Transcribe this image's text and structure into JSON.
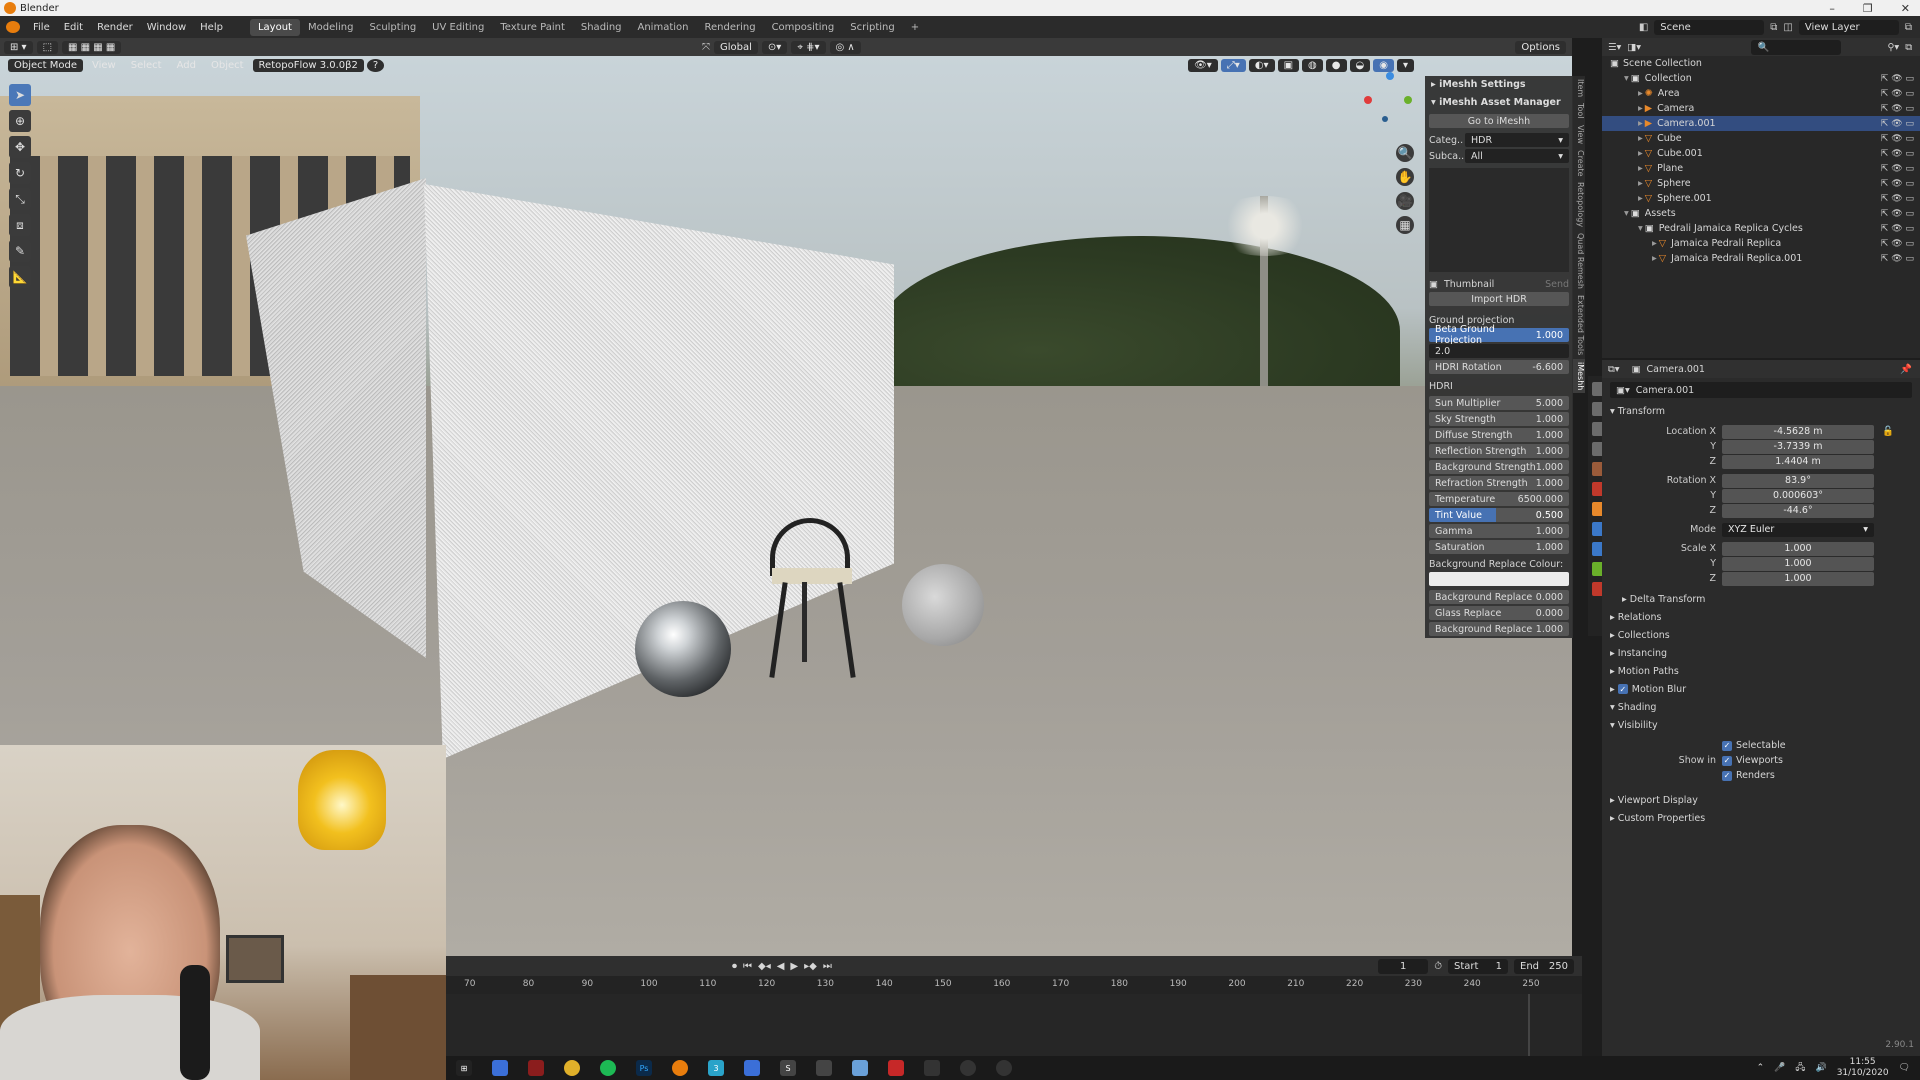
{
  "window": {
    "title": "Blender",
    "minimize": "–",
    "restore": "❐",
    "close": "✕"
  },
  "menu": {
    "items": [
      "File",
      "Edit",
      "Render",
      "Window",
      "Help"
    ],
    "workspaces": [
      "Layout",
      "Modeling",
      "Sculpting",
      "UV Editing",
      "Texture Paint",
      "Shading",
      "Animation",
      "Rendering",
      "Compositing",
      "Scripting",
      "+"
    ],
    "active_workspace": "Layout",
    "scene": "Scene",
    "view_layer": "View Layer"
  },
  "viewport_header": {
    "mode": "Object Mode",
    "view": "View",
    "select": "Select",
    "add": "Add",
    "object": "Object",
    "addon": "RetopoFlow 3.0.0β2",
    "help": "?",
    "orientation": "Global",
    "options": "Options"
  },
  "npanel": {
    "imeshh_settings": "iMeshh Settings",
    "asset_manager": "iMeshh Asset Manager",
    "go_to": "Go to iMeshh",
    "category_label": "Categ..",
    "category_value": "HDR",
    "subcategory_label": "Subca..",
    "subcategory_value": "All",
    "thumbnail": "Thumbnail",
    "send": "Send",
    "import": "Import HDR",
    "ground_projection": "Ground projection",
    "beta_ground": {
      "label": "Beta Ground Projection",
      "value": "1.000"
    },
    "ground_input": "2.0",
    "hdri_rotation": {
      "label": "HDRI Rotation",
      "value": "-6.600"
    },
    "hdri_section": "HDRI",
    "hdri_rows": [
      {
        "label": "Sun Multiplier",
        "value": "5.000"
      },
      {
        "label": "Sky Strength",
        "value": "1.000"
      },
      {
        "label": "Diffuse Strength",
        "value": "1.000"
      },
      {
        "label": "Reflection Strength",
        "value": "1.000"
      },
      {
        "label": "Background Strength",
        "value": "1.000"
      },
      {
        "label": "Refraction Strength",
        "value": "1.000"
      },
      {
        "label": "Temperature",
        "value": "6500.000"
      },
      {
        "label": "Tint Value",
        "value": "0.500"
      },
      {
        "label": "Gamma",
        "value": "1.000"
      },
      {
        "label": "Saturation",
        "value": "1.000"
      }
    ],
    "bg_replace_colour": "Background Replace Colour:",
    "bottom_rows": [
      {
        "label": "Background Replace",
        "value": "0.000"
      },
      {
        "label": "Glass Replace",
        "value": "0.000"
      },
      {
        "label": "Background Replace",
        "value": "1.000"
      }
    ]
  },
  "vtabs": [
    "Item",
    "Tool",
    "View",
    "Create",
    "Retopology",
    "Quad Remesh",
    "Extended Tools",
    "iMeshh"
  ],
  "outliner": {
    "root": "Scene Collection",
    "rows": [
      {
        "name": "Collection",
        "indent": 1,
        "kind": "collection"
      },
      {
        "name": "Area",
        "indent": 2,
        "kind": "light"
      },
      {
        "name": "Camera",
        "indent": 2,
        "kind": "camera"
      },
      {
        "name": "Camera.001",
        "indent": 2,
        "kind": "camera",
        "selected": true
      },
      {
        "name": "Cube",
        "indent": 2,
        "kind": "mesh"
      },
      {
        "name": "Cube.001",
        "indent": 2,
        "kind": "mesh"
      },
      {
        "name": "Plane",
        "indent": 2,
        "kind": "mesh"
      },
      {
        "name": "Sphere",
        "indent": 2,
        "kind": "mesh"
      },
      {
        "name": "Sphere.001",
        "indent": 2,
        "kind": "mesh"
      },
      {
        "name": "Assets",
        "indent": 1,
        "kind": "collection"
      },
      {
        "name": "Pedrali Jamaica Replica Cycles",
        "indent": 2,
        "kind": "collection"
      },
      {
        "name": "Jamaica Pedrali Replica",
        "indent": 3,
        "kind": "mesh"
      },
      {
        "name": "Jamaica Pedrali Replica.001",
        "indent": 3,
        "kind": "mesh"
      }
    ]
  },
  "properties": {
    "object_name": "Camera.001",
    "object_field": "Camera.001",
    "transform": "Transform",
    "location": {
      "label": "Location X",
      "x": "-4.5628 m",
      "y": "-3.7339 m",
      "z": "1.4404 m"
    },
    "rotation": {
      "label": "Rotation X",
      "x": "83.9°",
      "y": "0.000603°",
      "z": "-44.6°"
    },
    "mode": {
      "label": "Mode",
      "value": "XYZ Euler"
    },
    "scale": {
      "label": "Scale X",
      "x": "1.000",
      "y": "1.000",
      "z": "1.000"
    },
    "axis_y": "Y",
    "axis_z": "Z",
    "delta": "Delta Transform",
    "sections": [
      "Relations",
      "Collections",
      "Instancing",
      "Motion Paths",
      "Motion Blur",
      "Shading",
      "Visibility"
    ],
    "selectable": "Selectable",
    "show_in": "Show in",
    "viewports": "Viewports",
    "renders": "Renders",
    "sections2": [
      "Viewport Display",
      "Custom Properties"
    ]
  },
  "timeline": {
    "current_frame": "1",
    "start_label": "Start",
    "start": "1",
    "end_label": "End",
    "end": "250",
    "ticks": [
      "70",
      "80",
      "90",
      "100",
      "110",
      "120",
      "130",
      "140",
      "150",
      "160",
      "170",
      "180",
      "190",
      "200",
      "210",
      "220",
      "230",
      "240",
      "250"
    ]
  },
  "status": {
    "version": "2.90.1"
  },
  "taskbar": {
    "time": "11:55",
    "date": "31/10/2020"
  },
  "colors": {
    "accent": "#4772b3",
    "header": "#3a3a3a",
    "panel": "#2b2b2b",
    "selected": "#334d80"
  }
}
